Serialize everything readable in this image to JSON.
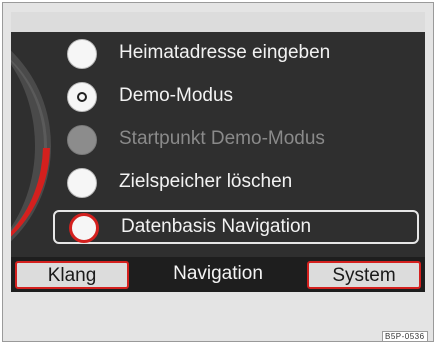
{
  "menu": {
    "items": [
      {
        "label": "Heimatadresse eingeben",
        "state": "normal"
      },
      {
        "label": "Demo-Modus",
        "state": "radio-selected"
      },
      {
        "label": "Startpunkt Demo-Modus",
        "state": "disabled"
      },
      {
        "label": "Zielspeicher löschen",
        "state": "normal"
      },
      {
        "label": "Datenbasis Navigation",
        "state": "highlighted"
      }
    ]
  },
  "tabs": {
    "left": "Klang",
    "middle": "Navigation",
    "right": "System",
    "active": "Navigation"
  },
  "image_code": "B5P-0536",
  "colors": {
    "accent_red": "#d4201e",
    "screen_bg": "#2f2f2f",
    "frame_bg": "#e4e4e4"
  }
}
